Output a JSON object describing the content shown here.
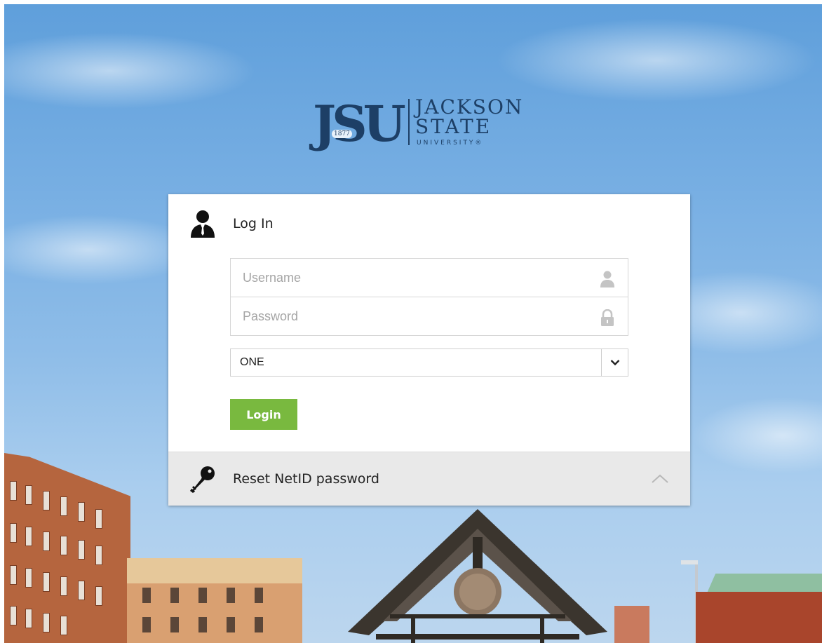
{
  "logo": {
    "mark": "JSU",
    "year": "1877",
    "line1": "JACKSON",
    "line2": "STATE",
    "line3": "UNIVERSITY®"
  },
  "login": {
    "title": "Log In",
    "icon": "user-icon",
    "username_placeholder": "Username",
    "username_value": "",
    "username_icon": "user-icon",
    "password_placeholder": "Password",
    "password_value": "",
    "password_icon": "lock-icon",
    "domain_selected": "ONE",
    "domain_icon": "chevron-down-icon",
    "submit_label": "Login"
  },
  "reset": {
    "label": "Reset NetID password",
    "icon": "key-icon",
    "toggle_icon": "chevron-up-icon"
  },
  "colors": {
    "brand": "#1d3f66",
    "login_button": "#79b93f",
    "reset_bg": "#e9e9e9"
  }
}
